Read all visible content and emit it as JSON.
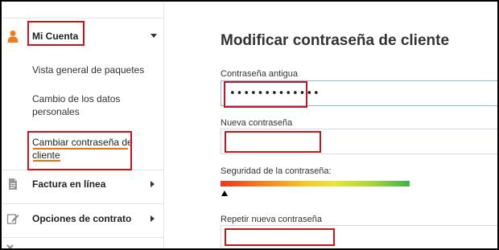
{
  "sidebar": {
    "account_label": "Mi Cuenta",
    "sub_items": [
      {
        "label": "Vista general de paquetes"
      },
      {
        "label": "Cambio de los datos personales"
      },
      {
        "label": "Cambiar contraseña de cliente"
      }
    ],
    "menu": [
      {
        "label": "Factura en línea",
        "icon": "document-icon"
      },
      {
        "label": "Opciones de contrato",
        "icon": "edit-icon"
      }
    ],
    "colors": {
      "account_icon": "#f07c1e",
      "active_underline": "#e8740c",
      "highlight_box": "#c8141e"
    }
  },
  "main": {
    "title": "Modificar contraseña de cliente",
    "old_password": {
      "label": "Contraseña antigua",
      "value": "•••••••••••••"
    },
    "new_password": {
      "label": "Nueva contraseña",
      "value": ""
    },
    "strength": {
      "label": "Seguridad de la contraseña:",
      "level": 0.0
    },
    "repeat_password": {
      "label": "Repetir nueva contraseña",
      "value": ""
    }
  }
}
